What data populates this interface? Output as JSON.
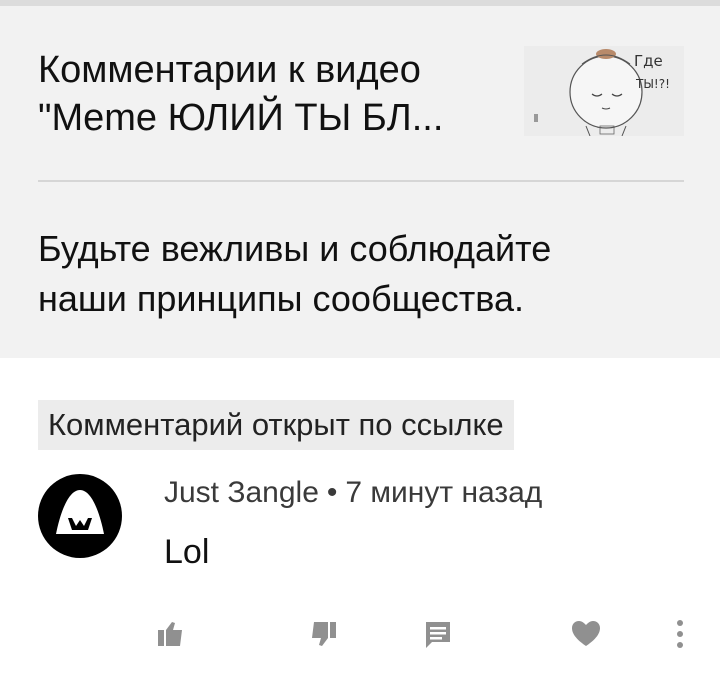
{
  "header": {
    "title_line1": "Комментарии к видео",
    "title_line2": "\"Meme ЮЛИЙ ТЫ БЛ...",
    "thumbnail_caption_line1": "Где",
    "thumbnail_caption_line2": "ТЫ!?!"
  },
  "notice": {
    "line1": "Будьте вежливы и соблюдайте",
    "line2": "наши принципы сообщества."
  },
  "linked_badge": "Комментарий открыт по ссылке",
  "comment": {
    "author": "Just Зangle",
    "separator": "•",
    "time": "7 минут назад",
    "text": "Lol"
  },
  "icons": {
    "avatar": "hooded-figure-avatar",
    "like": "thumbs-up-icon",
    "dislike": "thumbs-down-icon",
    "reply": "reply-comment-icon",
    "heart": "heart-icon",
    "more": "more-vert-icon"
  },
  "colors": {
    "header_bg": "#f2f2f2",
    "badge_bg": "#ececec",
    "icon_gray": "#909090"
  }
}
